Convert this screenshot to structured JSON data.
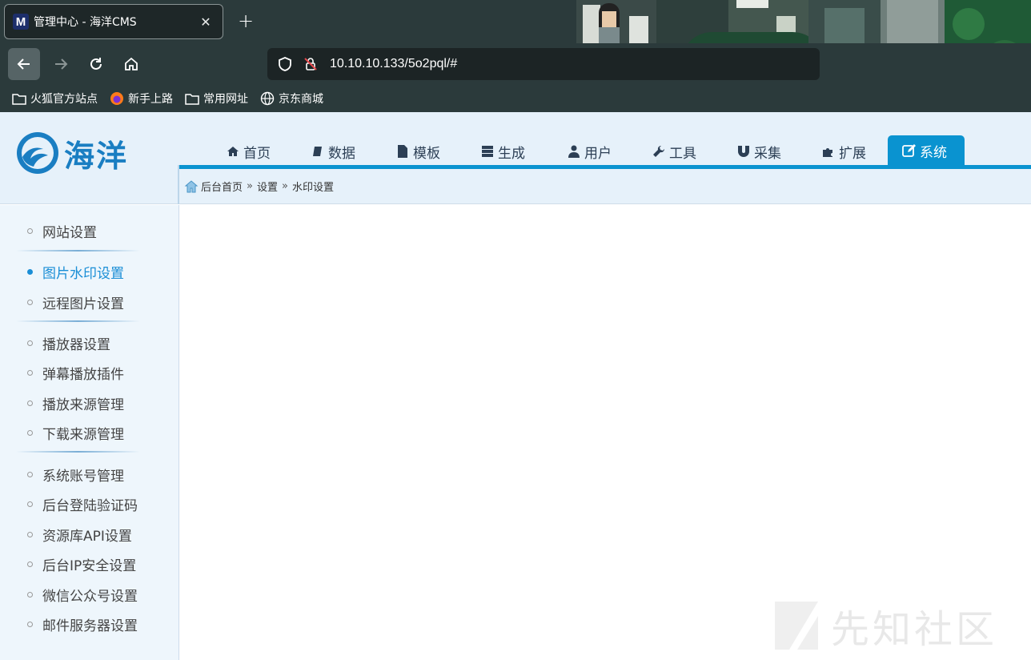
{
  "browser": {
    "tab_title": "管理中心 - 海洋CMS",
    "tab_favicon_letter": "M",
    "url": "10.10.10.133/5o2pql/#",
    "bookmarks": [
      {
        "label": "火狐官方站点",
        "icon": "folder-icon"
      },
      {
        "label": "新手上路",
        "icon": "firefox-icon"
      },
      {
        "label": "常用网址",
        "icon": "folder-icon"
      },
      {
        "label": "京东商城",
        "icon": "globe-icon"
      }
    ]
  },
  "cms": {
    "logo_text": "海洋",
    "nav": [
      {
        "label": "首页",
        "icon": "home-icon"
      },
      {
        "label": "数据",
        "icon": "book-icon"
      },
      {
        "label": "模板",
        "icon": "file-icon"
      },
      {
        "label": "生成",
        "icon": "server-icon"
      },
      {
        "label": "用户",
        "icon": "user-icon"
      },
      {
        "label": "工具",
        "icon": "wrench-icon"
      },
      {
        "label": "采集",
        "icon": "magnet-icon"
      },
      {
        "label": "扩展",
        "icon": "puzzle-icon"
      },
      {
        "label": "系统",
        "icon": "edit-icon",
        "active": true
      }
    ],
    "breadcrumb": [
      "后台首页",
      "设置",
      "水印设置"
    ],
    "breadcrumb_sep": "»",
    "sidebar": [
      {
        "label": "网站设置"
      },
      {
        "label": "图片水印设置",
        "active": true
      },
      {
        "label": "远程图片设置"
      },
      {
        "label": "播放器设置"
      },
      {
        "label": "弹幕播放插件"
      },
      {
        "label": "播放来源管理"
      },
      {
        "label": "下载来源管理"
      },
      {
        "label": "系统账号管理"
      },
      {
        "label": "后台登陆验证码"
      },
      {
        "label": "资源库API设置"
      },
      {
        "label": "后台IP安全设置"
      },
      {
        "label": "微信公众号设置"
      },
      {
        "label": "邮件服务器设置"
      }
    ],
    "accent_color": "#0a93d0"
  },
  "watermark_text": "先知社区"
}
